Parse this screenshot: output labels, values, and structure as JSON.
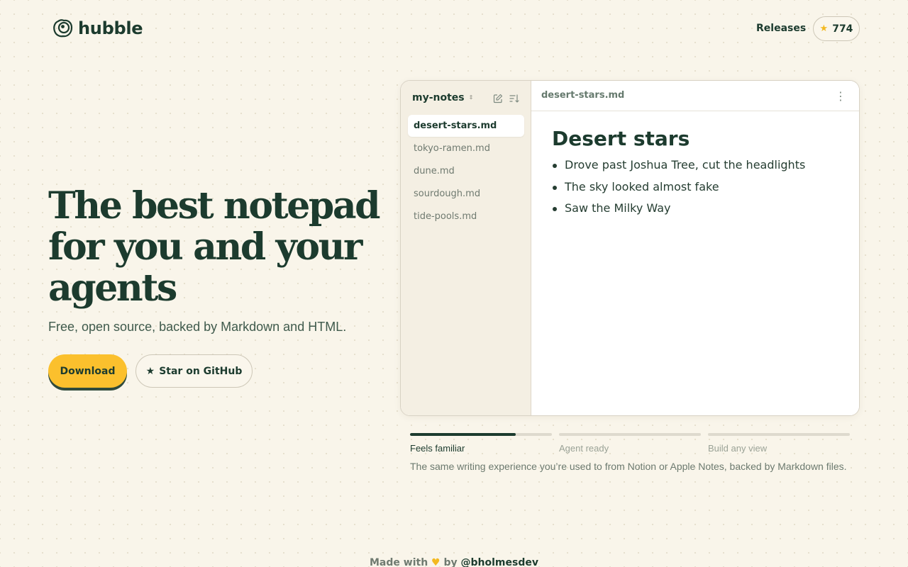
{
  "brand": {
    "name": "hubble",
    "logo_icon": "egg-eye-icon"
  },
  "nav": {
    "releases_label": "Releases",
    "github_stars": "774",
    "star_glyph": "★"
  },
  "hero": {
    "title_lines": [
      "The best notepad",
      "for you and your",
      "agents"
    ],
    "subtitle": "Free, open source, backed by Markdown and HTML.",
    "download_label": "Download",
    "github_button_label": "Star on GitHub",
    "github_button_icon": "star-icon"
  },
  "app": {
    "folder_name": "my-notes",
    "folder_caret": "⇕",
    "sidebar_icons": [
      "compose-icon",
      "sort-icon"
    ],
    "files": [
      {
        "name": "desert-stars.md",
        "active": true
      },
      {
        "name": "tokyo-ramen.md",
        "active": false
      },
      {
        "name": "dune.md",
        "active": false
      },
      {
        "name": "sourdough.md",
        "active": false
      },
      {
        "name": "tide-pools.md",
        "active": false
      }
    ],
    "open_file": "desert-stars.md",
    "menu_glyph": "⋮",
    "document": {
      "title": "Desert stars",
      "bullets": [
        "Drove past Joshua Tree, cut the headlights",
        "The sky looked almost fake",
        "Saw the Milky Way"
      ]
    }
  },
  "features": {
    "tabs": [
      {
        "label": "Feels familiar",
        "active": true,
        "progress": 0.745
      },
      {
        "label": "Agent ready",
        "active": false,
        "progress": 0
      },
      {
        "label": "Build any view",
        "active": false,
        "progress": 0
      }
    ],
    "description": "The same writing experience you’re used to from Notion or Apple Notes, backed by Markdown files."
  },
  "footer": {
    "prefix": "Made with",
    "heart": "♥",
    "by": "by",
    "handle": "@bholmesdev"
  },
  "colors": {
    "background": "#f9f5ea",
    "primary_text": "#1c3b2e",
    "accent_yellow": "#fbc02d",
    "sidebar_bg": "#f4efe3"
  }
}
